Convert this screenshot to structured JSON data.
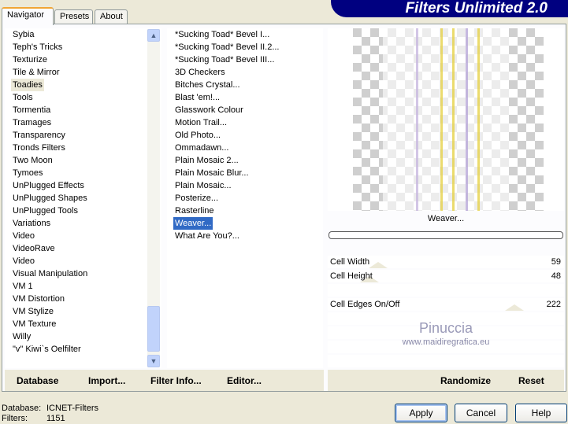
{
  "app_title": "Filters Unlimited 2.0",
  "tabs": [
    "Navigator",
    "Presets",
    "About"
  ],
  "categories": [
    "Sybia",
    "Teph's Tricks",
    "Texturize",
    "Tile & Mirror",
    "Toadies",
    "Tools",
    "Tormentia",
    "Tramages",
    "Transparency",
    "Tronds Filters",
    "Two Moon",
    "Tymoes",
    "UnPlugged Effects",
    "UnPlugged Shapes",
    "UnPlugged Tools",
    "Variations",
    "Video",
    "VideoRave",
    "Video",
    "Visual Manipulation",
    "VM 1",
    "VM Distortion",
    "VM Stylize",
    "VM Texture",
    "Willy",
    "\"v\" Kiwi`s Oelfilter"
  ],
  "selected_category": "Toadies",
  "filters": [
    "*Sucking Toad*  Bevel I...",
    "*Sucking Toad*  Bevel II.2...",
    "*Sucking Toad*  Bevel III...",
    "3D Checkers",
    "Bitches Crystal...",
    "Blast 'em!...",
    "Glasswork Colour",
    "Motion Trail...",
    "Old Photo...",
    "Ommadawn...",
    "Plain Mosaic 2...",
    "Plain Mosaic Blur...",
    "Plain Mosaic...",
    "Posterize...",
    "Rasterline",
    "Weaver...",
    "What Are You?..."
  ],
  "selected_filter": "Weaver...",
  "filter_name": "Weaver...",
  "progress": 0,
  "params": [
    {
      "label": "Cell Width",
      "value": 59
    },
    {
      "label": "Cell Height",
      "value": 48
    },
    {
      "label": "",
      "value": null
    },
    {
      "label": "Cell Edges On/Off",
      "value": 222
    }
  ],
  "watermark": {
    "name": "Pinuccia",
    "url": "www.maidiregrafica.eu"
  },
  "buttons": {
    "database": "Database",
    "import": "Import...",
    "filter_info": "Filter Info...",
    "editor": "Editor...",
    "randomize": "Randomize",
    "reset": "Reset",
    "apply": "Apply",
    "cancel": "Cancel",
    "help": "Help"
  },
  "status": {
    "database_label": "Database:",
    "database_value": "ICNET-Filters",
    "filters_label": "Filters:",
    "filters_value": "1151"
  }
}
